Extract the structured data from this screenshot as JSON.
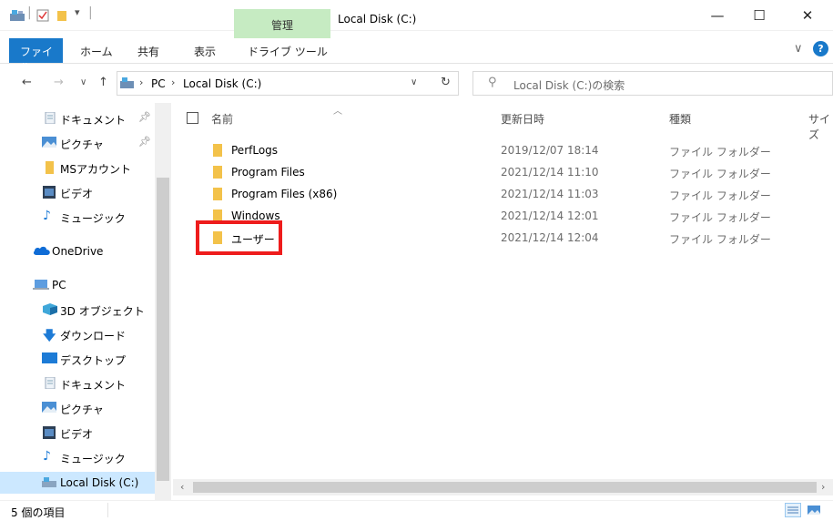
{
  "titlebar": {
    "manage_tab": "管理",
    "window_title": "Local Disk (C:)",
    "minimize": "—",
    "maximize": "☐",
    "close": "✕"
  },
  "ribbon": {
    "tabs": [
      "ファイル",
      "ホーム",
      "共有",
      "表示",
      "ドライブ ツール"
    ],
    "help": "?"
  },
  "address": {
    "path": [
      "PC",
      "Local Disk (C:)"
    ],
    "search_placeholder": "Local Disk (C:)の検索"
  },
  "navpane": {
    "items": [
      {
        "label": "ドキュメント",
        "icon": "documents-icon",
        "pinned": true
      },
      {
        "label": "ピクチャ",
        "icon": "pictures-icon",
        "pinned": true
      },
      {
        "label": "MSアカウント",
        "icon": "folder-icon",
        "pinned": false
      },
      {
        "label": "ビデオ",
        "icon": "videos-icon",
        "pinned": false
      },
      {
        "label": "ミュージック",
        "icon": "music-icon",
        "pinned": false
      },
      {
        "label": "OneDrive",
        "icon": "onedrive-icon",
        "pinned": false
      },
      {
        "label": "PC",
        "icon": "pc-icon",
        "pinned": false
      },
      {
        "label": "3D オブジェクト",
        "icon": "3d-objects-icon",
        "pinned": false
      },
      {
        "label": "ダウンロード",
        "icon": "downloads-icon",
        "pinned": false
      },
      {
        "label": "デスクトップ",
        "icon": "desktop-icon",
        "pinned": false
      },
      {
        "label": "ドキュメント",
        "icon": "documents-icon",
        "pinned": false
      },
      {
        "label": "ピクチャ",
        "icon": "pictures-icon",
        "pinned": false
      },
      {
        "label": "ビデオ",
        "icon": "videos-icon",
        "pinned": false
      },
      {
        "label": "ミュージック",
        "icon": "music-icon",
        "pinned": false
      },
      {
        "label": "Local Disk (C:)",
        "icon": "drive-icon",
        "pinned": false
      }
    ]
  },
  "list": {
    "columns": [
      "名前",
      "更新日時",
      "種類",
      "サイズ"
    ],
    "rows": [
      {
        "name": "PerfLogs",
        "date": "2019/12/07 18:14",
        "type": "ファイル フォルダー"
      },
      {
        "name": "Program Files",
        "date": "2021/12/14 11:10",
        "type": "ファイル フォルダー"
      },
      {
        "name": "Program Files (x86)",
        "date": "2021/12/14 11:03",
        "type": "ファイル フォルダー"
      },
      {
        "name": "Windows",
        "date": "2021/12/14 12:01",
        "type": "ファイル フォルダー"
      },
      {
        "name": "ユーザー",
        "date": "2021/12/14 12:04",
        "type": "ファイル フォルダー"
      }
    ]
  },
  "status": {
    "item_count": "5 個の項目"
  },
  "colors": {
    "accent": "#1979ca",
    "manage_tab": "#c6ebc2",
    "folder": "#f3c24a",
    "highlight": "#ee1c1c"
  }
}
